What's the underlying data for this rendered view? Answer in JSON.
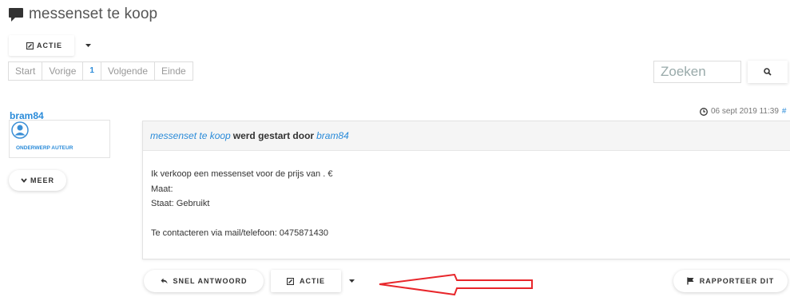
{
  "page_title": "messenset te koop",
  "top_action_label": "ACTIE",
  "pagination": [
    "Start",
    "Vorige",
    "1",
    "Volgende",
    "Einde"
  ],
  "search_placeholder": "Zoeken",
  "author": {
    "name": "bram84",
    "role": "ONDERWERP AUTEUR",
    "more_label": "MEER"
  },
  "post": {
    "date": "06 sept 2019 11:39",
    "hash": "#",
    "subject": "messenset te koop",
    "started_by": "werd gestart door",
    "starter": "bram84",
    "body_lines": [
      "Ik verkoop een messenset voor de prijs van . €",
      "Maat:",
      "Staat: Gebruikt",
      "",
      "Te contacteren via mail/telefoon: 0475871430"
    ]
  },
  "actions": {
    "reply": "SNEL ANTWOORD",
    "action": "ACTIE",
    "report": "RAPPORTEER DIT"
  },
  "colors": {
    "accent": "#2a8bd9",
    "arrow": "#e8262b"
  },
  "icons": [
    "comment-icon",
    "edit-icon",
    "caret-down-icon",
    "search-icon",
    "user-icon",
    "chevron-down-icon",
    "clock-icon",
    "reply-icon",
    "flag-icon"
  ]
}
